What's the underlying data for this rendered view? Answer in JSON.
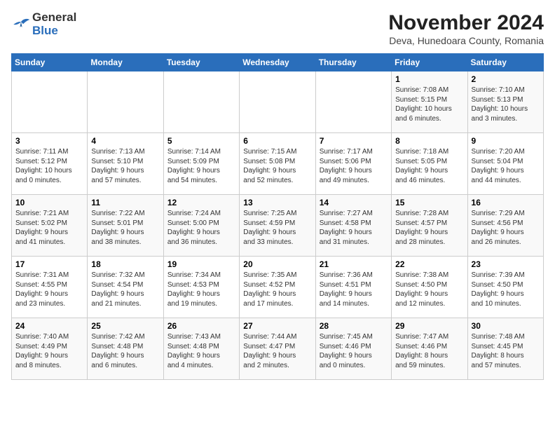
{
  "logo": {
    "line1": "General",
    "line2": "Blue"
  },
  "title": "November 2024",
  "subtitle": "Deva, Hunedoara County, Romania",
  "days_of_week": [
    "Sunday",
    "Monday",
    "Tuesday",
    "Wednesday",
    "Thursday",
    "Friday",
    "Saturday"
  ],
  "weeks": [
    [
      {
        "day": "",
        "info": ""
      },
      {
        "day": "",
        "info": ""
      },
      {
        "day": "",
        "info": ""
      },
      {
        "day": "",
        "info": ""
      },
      {
        "day": "",
        "info": ""
      },
      {
        "day": "1",
        "info": "Sunrise: 7:08 AM\nSunset: 5:15 PM\nDaylight: 10 hours\nand 6 minutes."
      },
      {
        "day": "2",
        "info": "Sunrise: 7:10 AM\nSunset: 5:13 PM\nDaylight: 10 hours\nand 3 minutes."
      }
    ],
    [
      {
        "day": "3",
        "info": "Sunrise: 7:11 AM\nSunset: 5:12 PM\nDaylight: 10 hours\nand 0 minutes."
      },
      {
        "day": "4",
        "info": "Sunrise: 7:13 AM\nSunset: 5:10 PM\nDaylight: 9 hours\nand 57 minutes."
      },
      {
        "day": "5",
        "info": "Sunrise: 7:14 AM\nSunset: 5:09 PM\nDaylight: 9 hours\nand 54 minutes."
      },
      {
        "day": "6",
        "info": "Sunrise: 7:15 AM\nSunset: 5:08 PM\nDaylight: 9 hours\nand 52 minutes."
      },
      {
        "day": "7",
        "info": "Sunrise: 7:17 AM\nSunset: 5:06 PM\nDaylight: 9 hours\nand 49 minutes."
      },
      {
        "day": "8",
        "info": "Sunrise: 7:18 AM\nSunset: 5:05 PM\nDaylight: 9 hours\nand 46 minutes."
      },
      {
        "day": "9",
        "info": "Sunrise: 7:20 AM\nSunset: 5:04 PM\nDaylight: 9 hours\nand 44 minutes."
      }
    ],
    [
      {
        "day": "10",
        "info": "Sunrise: 7:21 AM\nSunset: 5:02 PM\nDaylight: 9 hours\nand 41 minutes."
      },
      {
        "day": "11",
        "info": "Sunrise: 7:22 AM\nSunset: 5:01 PM\nDaylight: 9 hours\nand 38 minutes."
      },
      {
        "day": "12",
        "info": "Sunrise: 7:24 AM\nSunset: 5:00 PM\nDaylight: 9 hours\nand 36 minutes."
      },
      {
        "day": "13",
        "info": "Sunrise: 7:25 AM\nSunset: 4:59 PM\nDaylight: 9 hours\nand 33 minutes."
      },
      {
        "day": "14",
        "info": "Sunrise: 7:27 AM\nSunset: 4:58 PM\nDaylight: 9 hours\nand 31 minutes."
      },
      {
        "day": "15",
        "info": "Sunrise: 7:28 AM\nSunset: 4:57 PM\nDaylight: 9 hours\nand 28 minutes."
      },
      {
        "day": "16",
        "info": "Sunrise: 7:29 AM\nSunset: 4:56 PM\nDaylight: 9 hours\nand 26 minutes."
      }
    ],
    [
      {
        "day": "17",
        "info": "Sunrise: 7:31 AM\nSunset: 4:55 PM\nDaylight: 9 hours\nand 23 minutes."
      },
      {
        "day": "18",
        "info": "Sunrise: 7:32 AM\nSunset: 4:54 PM\nDaylight: 9 hours\nand 21 minutes."
      },
      {
        "day": "19",
        "info": "Sunrise: 7:34 AM\nSunset: 4:53 PM\nDaylight: 9 hours\nand 19 minutes."
      },
      {
        "day": "20",
        "info": "Sunrise: 7:35 AM\nSunset: 4:52 PM\nDaylight: 9 hours\nand 17 minutes."
      },
      {
        "day": "21",
        "info": "Sunrise: 7:36 AM\nSunset: 4:51 PM\nDaylight: 9 hours\nand 14 minutes."
      },
      {
        "day": "22",
        "info": "Sunrise: 7:38 AM\nSunset: 4:50 PM\nDaylight: 9 hours\nand 12 minutes."
      },
      {
        "day": "23",
        "info": "Sunrise: 7:39 AM\nSunset: 4:50 PM\nDaylight: 9 hours\nand 10 minutes."
      }
    ],
    [
      {
        "day": "24",
        "info": "Sunrise: 7:40 AM\nSunset: 4:49 PM\nDaylight: 9 hours\nand 8 minutes."
      },
      {
        "day": "25",
        "info": "Sunrise: 7:42 AM\nSunset: 4:48 PM\nDaylight: 9 hours\nand 6 minutes."
      },
      {
        "day": "26",
        "info": "Sunrise: 7:43 AM\nSunset: 4:48 PM\nDaylight: 9 hours\nand 4 minutes."
      },
      {
        "day": "27",
        "info": "Sunrise: 7:44 AM\nSunset: 4:47 PM\nDaylight: 9 hours\nand 2 minutes."
      },
      {
        "day": "28",
        "info": "Sunrise: 7:45 AM\nSunset: 4:46 PM\nDaylight: 9 hours\nand 0 minutes."
      },
      {
        "day": "29",
        "info": "Sunrise: 7:47 AM\nSunset: 4:46 PM\nDaylight: 8 hours\nand 59 minutes."
      },
      {
        "day": "30",
        "info": "Sunrise: 7:48 AM\nSunset: 4:45 PM\nDaylight: 8 hours\nand 57 minutes."
      }
    ]
  ]
}
